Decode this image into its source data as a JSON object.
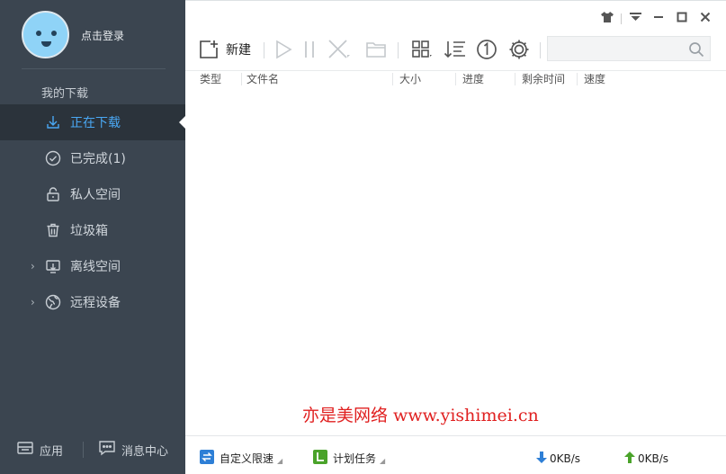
{
  "sidebar": {
    "login_text": "点击登录",
    "section_label": "我的下载",
    "items": [
      {
        "label": "正在下载",
        "icon": "download-icon",
        "active": true,
        "expandable": false
      },
      {
        "label": "已完成(1)",
        "icon": "check-circle-icon",
        "active": false,
        "expandable": false
      },
      {
        "label": "私人空间",
        "icon": "lock-icon",
        "active": false,
        "expandable": false
      },
      {
        "label": "垃圾箱",
        "icon": "trash-icon",
        "active": false,
        "expandable": false
      },
      {
        "label": "离线空间",
        "icon": "offline-download-icon",
        "active": false,
        "expandable": true
      },
      {
        "label": "远程设备",
        "icon": "globe-icon",
        "active": false,
        "expandable": true
      }
    ],
    "bottom": {
      "apps_label": "应用",
      "messages_label": "消息中心"
    }
  },
  "toolbar": {
    "new_label": "新建",
    "search_placeholder": ""
  },
  "table": {
    "columns": [
      "类型",
      "文件名",
      "大小",
      "进度",
      "剩余时间",
      "速度"
    ],
    "rows": []
  },
  "watermark": "亦是美网络 www.yishimei.cn",
  "status_bar": {
    "speed_limit_label": "自定义限速",
    "schedule_label": "计划任务",
    "download_speed": "0KB/s",
    "upload_speed": "0KB/s"
  },
  "colors": {
    "sidebar_bg": "#3b4550",
    "active_bg": "#2b333b",
    "accent": "#4aa8f4",
    "watermark": "#e02020",
    "download_arrow": "#2e7fd6",
    "upload_arrow": "#4aa32a"
  }
}
